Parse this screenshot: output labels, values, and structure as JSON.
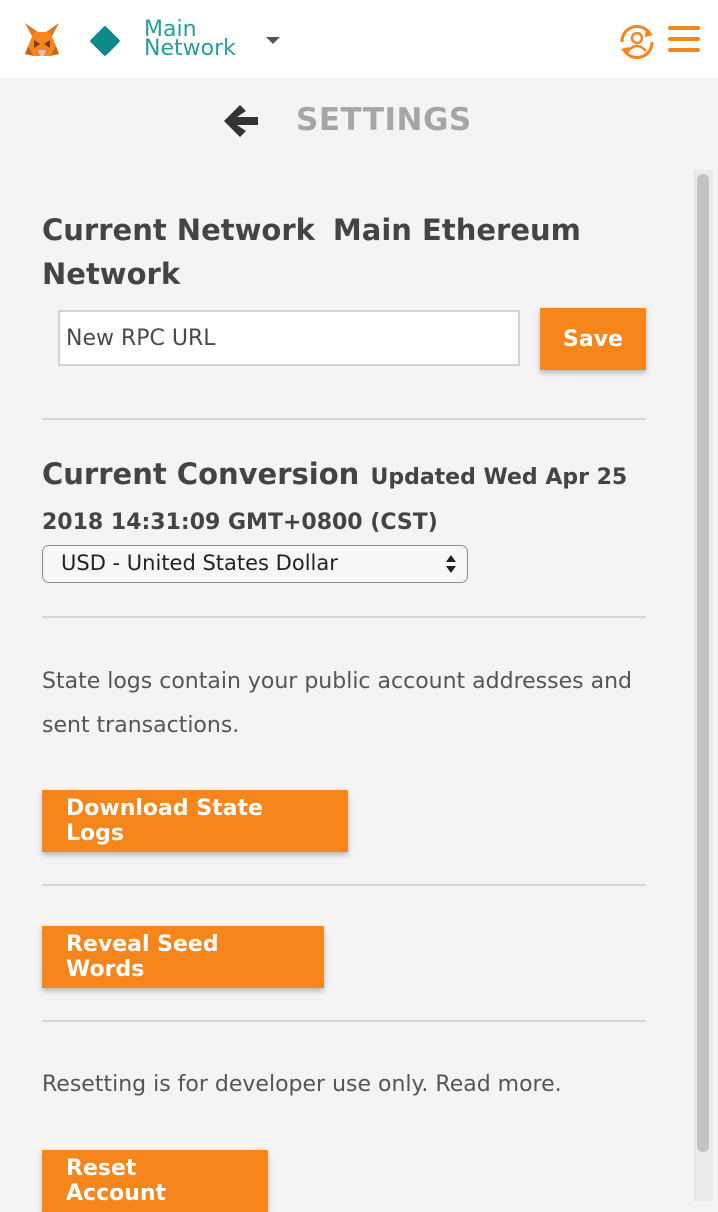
{
  "header": {
    "network_line1": "Main",
    "network_line2": "Network",
    "icons": [
      "metamask-fox-icon",
      "network-diamond-icon",
      "chevron-down-icon",
      "account-switch-icon",
      "hamburger-menu-icon"
    ]
  },
  "page": {
    "title": "SETTINGS"
  },
  "current_network": {
    "label": "Current Network",
    "value": "Main Ethereum Network",
    "rpc_input": {
      "placeholder": "New RPC URL",
      "value": ""
    },
    "save_label": "Save"
  },
  "current_conversion": {
    "label": "Current Conversion",
    "updated_text": "Updated Wed Apr 25 2018 14:31:09 GMT+0800 (CST)",
    "selected_currency": "USD - United States Dollar"
  },
  "state_logs": {
    "description": "State logs contain your public account addresses and sent transactions.",
    "button_label": "Download State Logs"
  },
  "seed_words": {
    "button_label": "Reveal Seed Words"
  },
  "reset": {
    "description": "Resetting is for developer use only. Read more.",
    "button_label": "Reset Account"
  },
  "colors": {
    "accent": "#f6851b",
    "network": "#0f8a8a",
    "background": "#f4f4f4"
  }
}
